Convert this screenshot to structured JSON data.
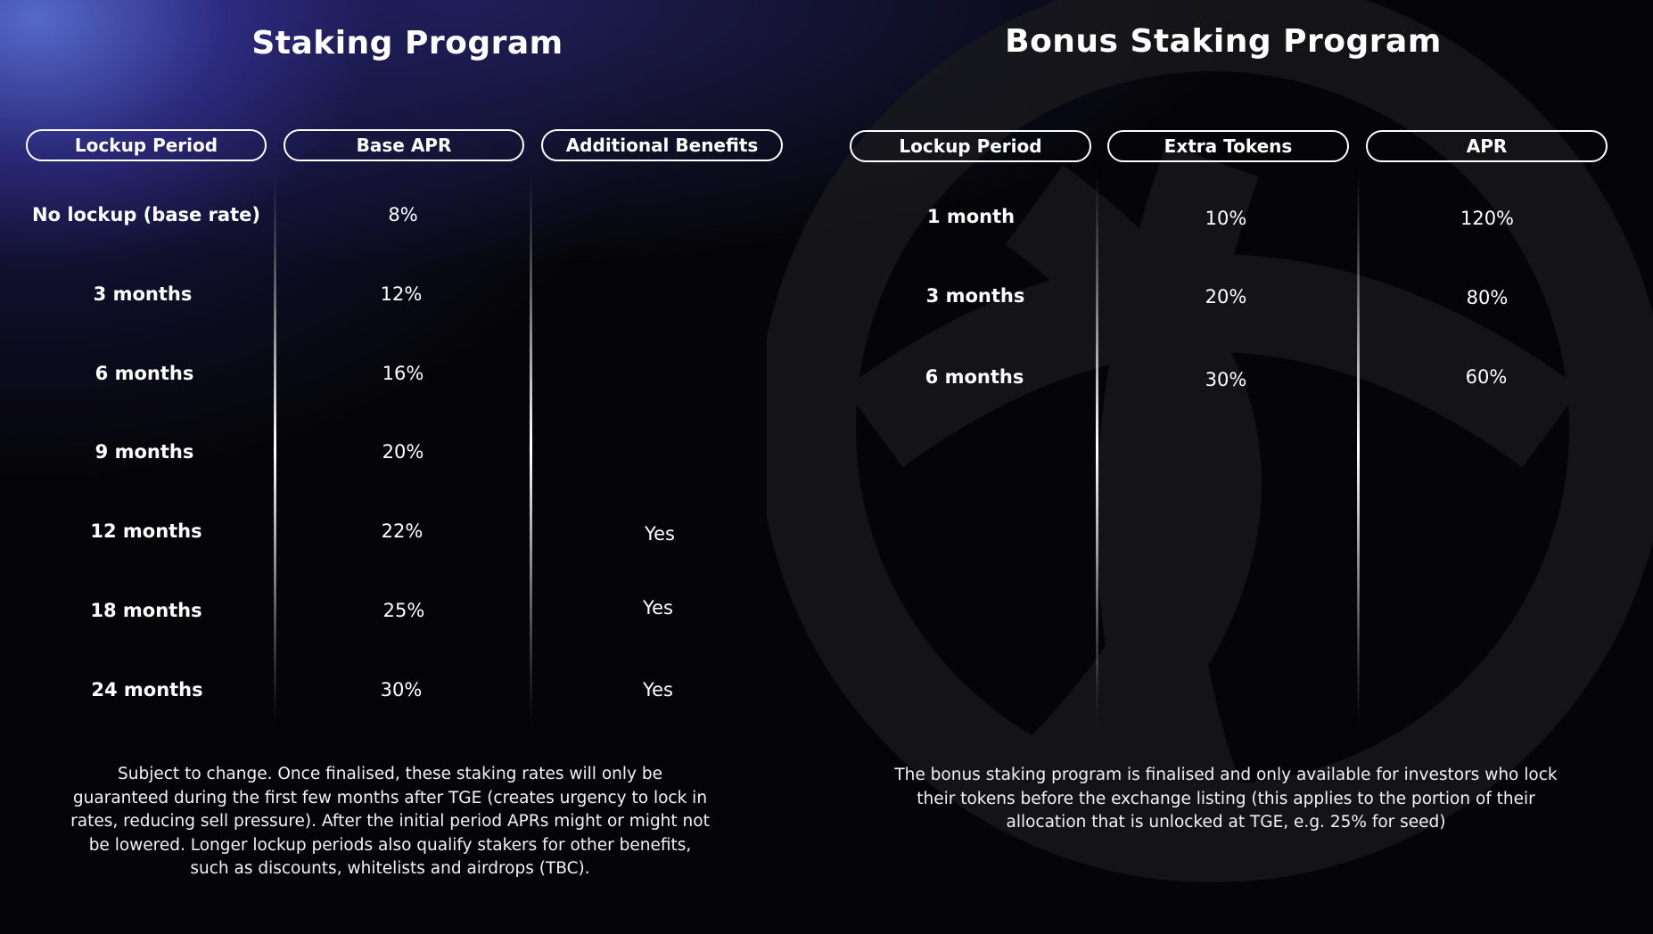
{
  "left": {
    "title": "Staking Program",
    "headers": [
      "Lockup Period",
      "Base APR",
      "Additional Benefits"
    ],
    "rows": [
      {
        "period": "No lockup (base rate)",
        "apr": "8%",
        "benefit": ""
      },
      {
        "period": "3 months",
        "apr": "12%",
        "benefit": ""
      },
      {
        "period": "6 months",
        "apr": "16%",
        "benefit": ""
      },
      {
        "period": "9 months",
        "apr": "20%",
        "benefit": ""
      },
      {
        "period": "12 months",
        "apr": "22%",
        "benefit": "Yes"
      },
      {
        "period": "18 months",
        "apr": "25%",
        "benefit": "Yes"
      },
      {
        "period": "24 months",
        "apr": "30%",
        "benefit": "Yes"
      }
    ],
    "note_lines": [
      "Subject to change. Once finalised, these staking rates will only be",
      "guaranteed during the first few months after TGE (creates urgency to lock in",
      "rates, reducing sell pressure). After the initial period APRs might or might not",
      "be lowered. Longer lockup periods also qualify stakers for other benefits,",
      "such as discounts, whitelists and airdrops (TBC)."
    ]
  },
  "right": {
    "title": "Bonus Staking Program",
    "headers": [
      "Lockup Period",
      "Extra Tokens",
      "APR"
    ],
    "rows": [
      {
        "period": "1 month",
        "extra": "10%",
        "apr": "120%"
      },
      {
        "period": "3 months",
        "extra": "20%",
        "apr": "80%"
      },
      {
        "period": "6 months",
        "extra": "30%",
        "apr": "60%"
      }
    ],
    "note_lines": [
      "The bonus staking program is finalised and only available for investors who lock",
      "their tokens before the exchange listing (this applies to the portion of their",
      "allocation that is unlocked at TGE, e.g. 25% for seed)"
    ]
  }
}
